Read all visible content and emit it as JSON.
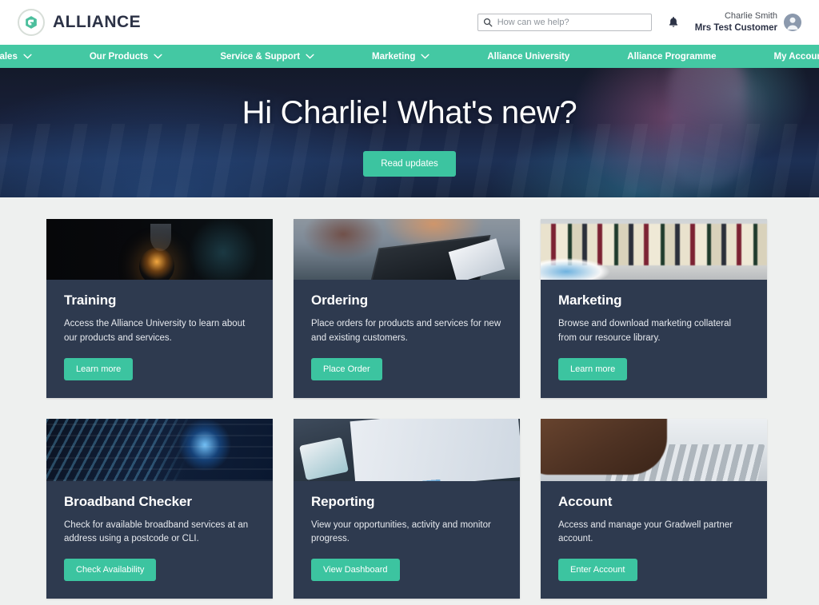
{
  "brand": {
    "name": "ALLIANCE",
    "logo_icon": "alliance-g-logo",
    "accent_color": "#3cc4a0",
    "nav_bar_color": "#44c8a3",
    "card_bg_color": "#2e3a4f"
  },
  "header": {
    "search": {
      "placeholder": "How can we help?",
      "value": "",
      "icon": "search-icon"
    },
    "notifications_icon": "bell-icon",
    "account": {
      "user_name": "Charlie Smith",
      "company_name": "Mrs Test Customer",
      "avatar_icon": "user-avatar-icon"
    }
  },
  "nav": {
    "items": [
      {
        "label": "Sales",
        "has_dropdown": true
      },
      {
        "label": "Our Products",
        "has_dropdown": true
      },
      {
        "label": "Service & Support",
        "has_dropdown": true
      },
      {
        "label": "Marketing",
        "has_dropdown": true
      },
      {
        "label": "Alliance University",
        "has_dropdown": false
      },
      {
        "label": "Alliance Programme",
        "has_dropdown": false
      },
      {
        "label": "My Account",
        "has_dropdown": false
      }
    ]
  },
  "hero": {
    "heading": "Hi Charlie! What's new?",
    "cta_label": "Read updates"
  },
  "cards": [
    {
      "title": "Training",
      "description": "Access the Alliance University to learn about our products and services.",
      "button_label": "Learn more",
      "image": "lightbulb-photo"
    },
    {
      "title": "Ordering",
      "description": "Place orders for products and services for new and existing customers.",
      "button_label": "Place Order",
      "image": "calculator-desk-photo"
    },
    {
      "title": "Marketing",
      "description": "Browse and download marketing collateral from our resource library.",
      "button_label": "Learn more",
      "image": "bookshelf-photo"
    },
    {
      "title": "Broadband Checker",
      "description": "Check for available broadband services at an address using a postcode or CLI.",
      "button_label": "Check Availability",
      "image": "network-cables-photo"
    },
    {
      "title": "Reporting",
      "description": "View your opportunities, activity and monitor progress.",
      "button_label": "View Dashboard",
      "image": "charts-paperwork-photo"
    },
    {
      "title": "Account",
      "description": "Access and manage your Gradwell partner account.",
      "button_label": "Enter Account",
      "image": "hands-laptop-photo"
    }
  ]
}
